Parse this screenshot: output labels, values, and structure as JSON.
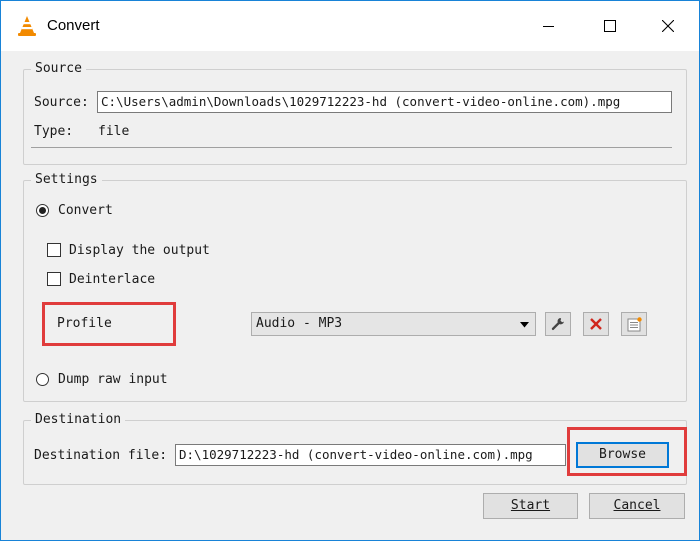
{
  "window": {
    "title": "Convert"
  },
  "source": {
    "group_label": "Source",
    "source_label": "Source:",
    "source_value": "C:\\Users\\admin\\Downloads\\1029712223-hd (convert-video-online.com).mpg",
    "type_label": "Type:",
    "type_value": "file"
  },
  "settings": {
    "group_label": "Settings",
    "convert_label": "Convert",
    "convert_selected": true,
    "display_output_label": "Display the output",
    "display_output_checked": false,
    "deinterlace_label": "Deinterlace",
    "deinterlace_checked": false,
    "profile_label": "Profile",
    "profile_value": "Audio - MP3",
    "dump_raw_label": "Dump raw input",
    "dump_raw_selected": false
  },
  "destination": {
    "group_label": "Destination",
    "file_label": "Destination file:",
    "file_value": "D:\\1029712223-hd (convert-video-online.com).mpg",
    "browse_label": "Browse"
  },
  "actions": {
    "start_label": "Start",
    "cancel_label": "Cancel"
  },
  "colors": {
    "highlight": "#e03c3c",
    "accent": "#0078d7",
    "vlc_orange": "#f28a00"
  },
  "icons": [
    "vlc-cone-icon",
    "minimize-icon",
    "maximize-icon",
    "close-icon",
    "wrench-icon",
    "delete-icon",
    "new-profile-icon",
    "chevron-down-icon"
  ]
}
